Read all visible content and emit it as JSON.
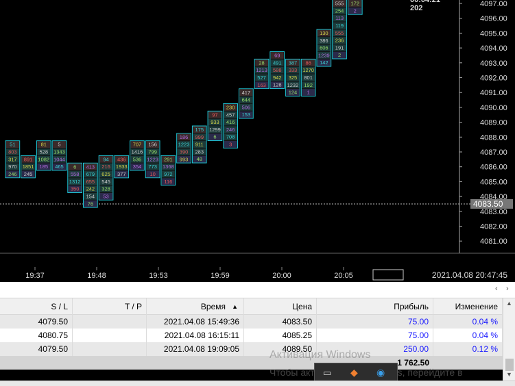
{
  "price_axis": {
    "ticks": [
      "4097.00",
      "4096.00",
      "4095.00",
      "4094.00",
      "4093.00",
      "4092.00",
      "4091.00",
      "4090.00",
      "4089.00",
      "4088.00",
      "4087.00",
      "4086.00",
      "4085.00",
      "4084.00",
      "4083.00",
      "4082.00",
      "4081.00"
    ],
    "current_price": "4083.50"
  },
  "time_axis": {
    "ticks": [
      "19:37",
      "19:48",
      "19:53",
      "19:59",
      "20:00",
      "20:05"
    ],
    "datetime": "2021.04.08 20:47:45"
  },
  "top_label": {
    "time": "00:04:21",
    "count": "202"
  },
  "clusters": [
    {
      "vals": [
        "51",
        "803",
        "317",
        "970",
        "246"
      ]
    },
    {
      "vals": [
        "891",
        "1851",
        "245"
      ]
    },
    {
      "vals": [
        "81",
        "528",
        "1082",
        "185"
      ]
    },
    {
      "vals": [
        "5",
        "1343",
        "1044",
        "465"
      ]
    },
    {
      "vals": [
        "6",
        "558",
        "1312",
        "350"
      ]
    },
    {
      "vals": [
        "413",
        "679",
        "655",
        "242",
        "154",
        "76"
      ]
    },
    {
      "vals": [
        "94",
        "216",
        "625",
        "545",
        "328",
        "53"
      ]
    },
    {
      "vals": [
        "436",
        "1933",
        "377"
      ]
    },
    {
      "vals": [
        "707",
        "1416",
        "536",
        "354"
      ]
    },
    {
      "vals": [
        "156",
        "799",
        "1223",
        "773",
        "10"
      ]
    },
    {
      "vals": [
        "291",
        "1368",
        "972",
        "116"
      ]
    },
    {
      "vals": [
        "186",
        "1223",
        "390",
        "993"
      ]
    },
    {
      "vals": [
        "175",
        "999",
        "911",
        "283",
        "48"
      ]
    },
    {
      "vals": [
        "97",
        "933",
        "1299",
        "6"
      ]
    },
    {
      "vals": [
        "230",
        "457",
        "416",
        "246",
        "708",
        "3"
      ]
    },
    {
      "vals": [
        "417",
        "644",
        "506",
        "153"
      ]
    },
    {
      "vals": [
        "28",
        "1213",
        "527",
        "163"
      ]
    },
    {
      "vals": [
        "69",
        "491",
        "588",
        "942",
        "128"
      ]
    },
    {
      "vals": [
        "387",
        "333",
        "325",
        "1232",
        "124"
      ]
    },
    {
      "vals": [
        "86",
        "1270",
        "801",
        "192",
        "1"
      ]
    },
    {
      "vals": [
        "130",
        "386",
        "606",
        "1239",
        "142"
      ]
    },
    {
      "vals": [
        "555",
        "254",
        "113",
        "119",
        "555",
        "236",
        "191",
        "2"
      ]
    },
    {
      "vals": [
        "172",
        "2"
      ]
    }
  ],
  "table": {
    "columns": [
      "S / L",
      "T / P",
      "Время",
      "Цена",
      "Прибыль",
      "Изменение"
    ],
    "rows": [
      {
        "sl": "4079.50",
        "tp": "",
        "time": "2021.04.08 15:49:36",
        "price": "4083.50",
        "profit": "75.00",
        "change": "0.04 %"
      },
      {
        "sl": "4080.75",
        "tp": "",
        "time": "2021.04.08 16:15:11",
        "price": "4085.25",
        "profit": "75.00",
        "change": "0.04 %"
      },
      {
        "sl": "4079.50",
        "tp": "",
        "time": "2021.04.08 19:09:05",
        "price": "4089.50",
        "profit": "250.00",
        "change": "0.12 %"
      }
    ],
    "total": "1 762.50"
  },
  "watermark": {
    "line1": "Активация Windows",
    "line2": "Чтобы активировать Windows, перейдите в"
  },
  "colors": {
    "cyan": "#1ec8d8",
    "green": "#7ddf5a",
    "red": "#d04a4a",
    "purple": "#8a4ad0",
    "grid": "#333333"
  }
}
